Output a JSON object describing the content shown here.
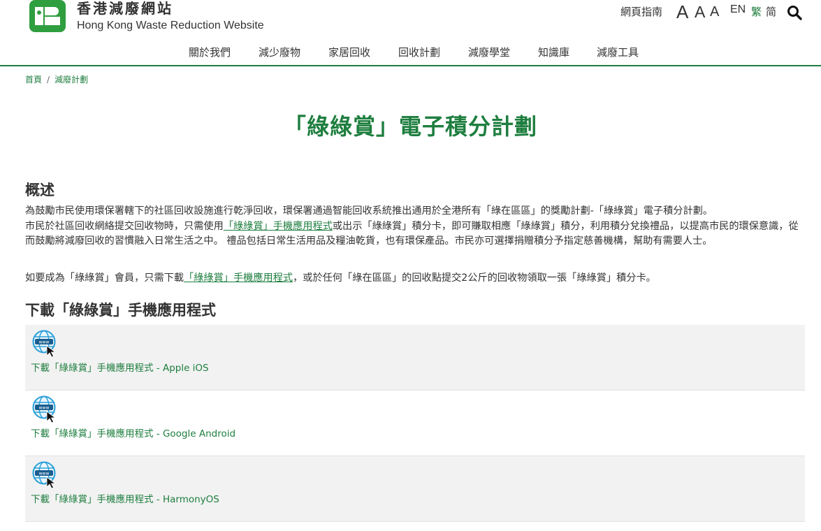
{
  "header": {
    "site_name_zh": "香港減廢網站",
    "site_name_en": "Hong Kong Waste Reduction Website",
    "sitemap_label": "網頁指南",
    "font_size_labels": [
      "A",
      "A",
      "A"
    ],
    "lang_en": "EN",
    "lang_tc": "繁",
    "lang_sc": "简",
    "search_icon": "search-icon",
    "logo_icon": "hkwr-logo-icon"
  },
  "nav": {
    "items": [
      "關於我們",
      "減少廢物",
      "家居回收",
      "回收計劃",
      "減廢學堂",
      "知識庫",
      "減廢工具"
    ]
  },
  "breadcrumb": {
    "home": "首頁",
    "separator": "/",
    "current": "減廢計劃"
  },
  "page": {
    "title": "「綠綠賞」電子積分計劃"
  },
  "overview": {
    "heading": "概述",
    "text_1": "為鼓勵市民使用環保署轄下的社區回收設施進行乾淨回收，環保署通過智能回收系統推出通用於全港所有「綠在區區」的獎勵計劃-「綠綠賞」電子積分計劃。",
    "text_2a": "市民於社區回收網絡提交回收物時，只需使用",
    "link_1": "「綠綠賞」手機應用程式",
    "text_2b": "或出示「綠綠賞」積分卡，即可賺取相應「綠綠賞」積分，利用積分兌換禮品，以提高市民的環保意識，從而鼓勵將減廢回收的習慣融入日常生活之中。 禮品包括日常生活用品及糧油乾貨，也有環保產品。市民亦可選擇捐贈積分予指定慈善機構，幫助有需要人士。",
    "text_3a": "如要成為「綠綠賞」會員，只需下載",
    "link_2": "「綠綠賞」手機應用程式",
    "text_3b": "，或於任何「綠在區區」的回收點提交2公斤的回收物領取一張「綠綠賞」積分卡。"
  },
  "download": {
    "heading": "下載「綠綠賞」手機應用程式",
    "items": [
      {
        "label": "下載「綠綠賞」手機應用程式 - Apple iOS",
        "icon": "web-link-icon"
      },
      {
        "label": "下載「綠綠賞」手機應用程式 - Google Android",
        "icon": "web-link-icon"
      },
      {
        "label": "下載「綠綠賞」手機應用程式 - HarmonyOS",
        "icon": "web-link-icon"
      }
    ],
    "icon_text": "www"
  },
  "colors": {
    "brand_green": "#1e7e3f",
    "text": "#333333",
    "row_alt": "#f2f2f2"
  }
}
